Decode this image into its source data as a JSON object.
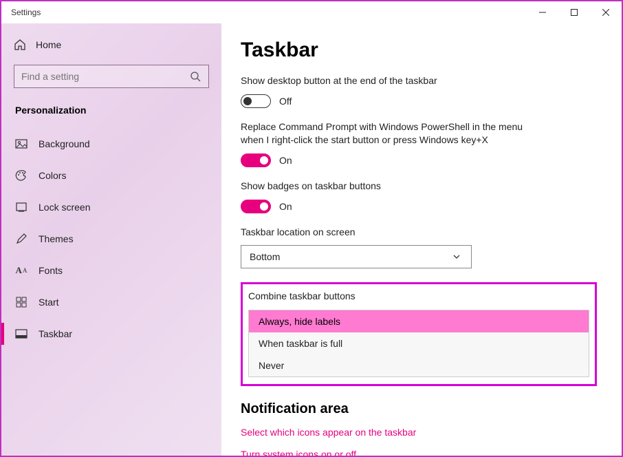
{
  "window": {
    "title": "Settings"
  },
  "sidebar": {
    "home": "Home",
    "search_placeholder": "Find a setting",
    "category": "Personalization",
    "items": [
      {
        "label": "Background"
      },
      {
        "label": "Colors"
      },
      {
        "label": "Lock screen"
      },
      {
        "label": "Themes"
      },
      {
        "label": "Fonts"
      },
      {
        "label": "Start"
      },
      {
        "label": "Taskbar"
      }
    ]
  },
  "page": {
    "title": "Taskbar",
    "s1": {
      "label": "Show desktop button at the end of the taskbar",
      "state": "Off"
    },
    "s2": {
      "label": "Replace Command Prompt with Windows PowerShell in the menu when I right-click the start button or press Windows key+X",
      "state": "On"
    },
    "s3": {
      "label": "Show badges on taskbar buttons",
      "state": "On"
    },
    "loc": {
      "label": "Taskbar location on screen",
      "value": "Bottom"
    },
    "combine": {
      "label": "Combine taskbar buttons",
      "options": [
        "Always, hide labels",
        "When taskbar is full",
        "Never"
      ]
    },
    "section2": "Notification area",
    "link1": "Select which icons appear on the taskbar",
    "link2": "Turn system icons on or off"
  }
}
